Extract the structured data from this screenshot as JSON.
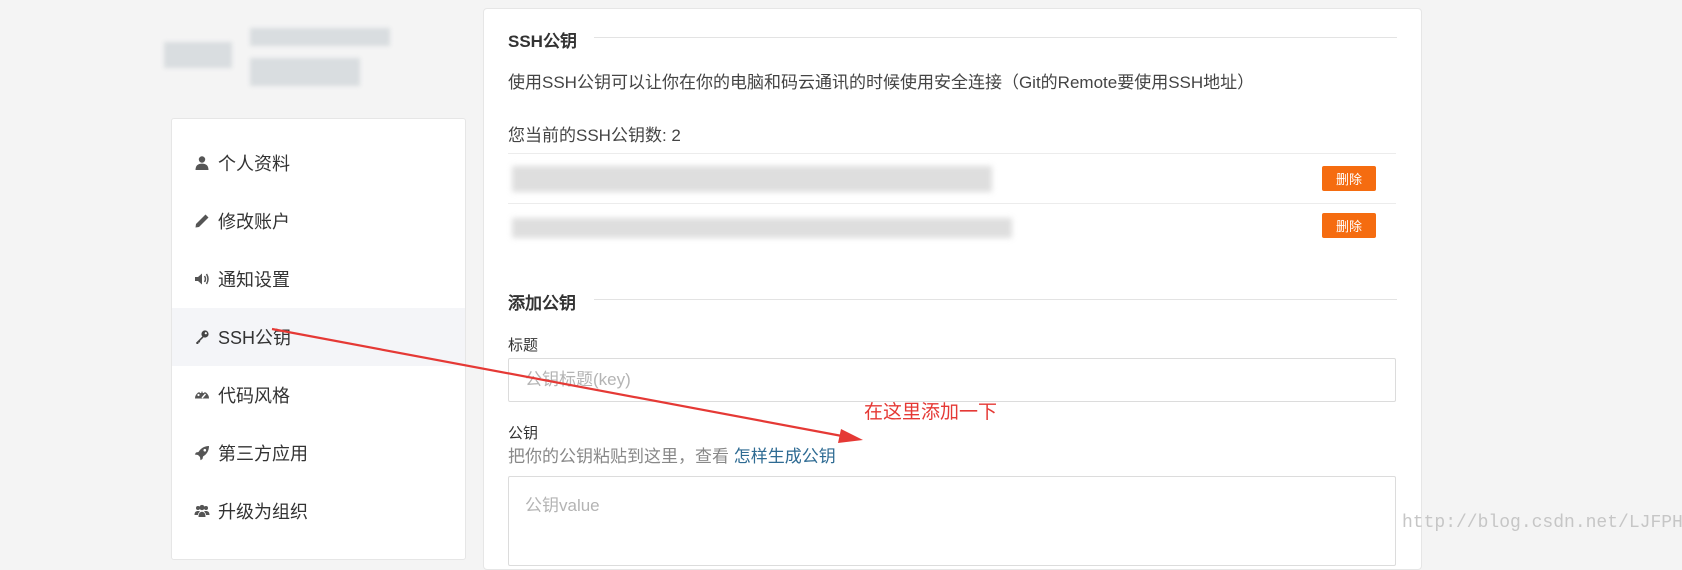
{
  "sidebar": {
    "items": [
      {
        "label": "个人资料",
        "icon": "user-icon",
        "active": false
      },
      {
        "label": "修改账户",
        "icon": "pencil-icon",
        "active": false
      },
      {
        "label": "通知设置",
        "icon": "speaker-icon",
        "active": false
      },
      {
        "label": "SSH公钥",
        "icon": "key-icon",
        "active": true
      },
      {
        "label": "代码风格",
        "icon": "palette-icon",
        "active": false
      },
      {
        "label": "第三方应用",
        "icon": "rocket-icon",
        "active": false
      },
      {
        "label": "升级为组织",
        "icon": "users-icon",
        "active": false
      }
    ]
  },
  "ssh_section": {
    "title": "SSH公钥",
    "description": "使用SSH公钥可以让你在你的电脑和码云通讯的时候使用安全连接（Git的Remote要使用SSH地址）",
    "key_count_text": "您当前的SSH公钥数: 2",
    "delete_label": "删除"
  },
  "add_section": {
    "title": "添加公钥",
    "title_label": "标题",
    "title_placeholder": "公钥标题(key)",
    "key_label": "公钥",
    "hint_text": "把你的公钥粘贴到这里，查看 ",
    "hint_link": "怎样生成公钥",
    "key_placeholder": "公钥value"
  },
  "annotation": "在这里添加一下",
  "watermark": "http://blog.csdn.net/LJFPHP",
  "colors": {
    "delete_button": "#f56c10",
    "annotation": "#e53935",
    "link": "#2e6b93",
    "active_nav_bg": "#f4f5f8"
  }
}
